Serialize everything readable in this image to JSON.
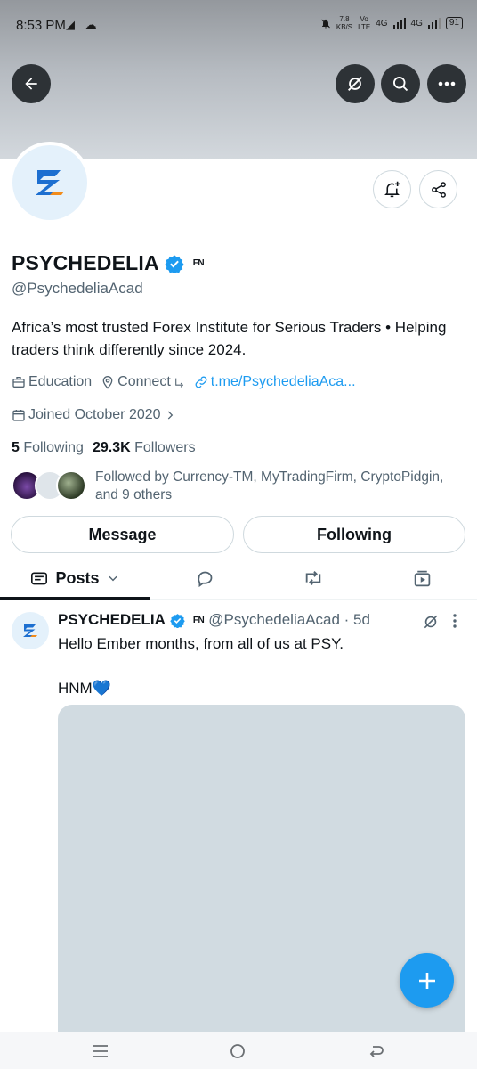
{
  "status_bar": {
    "time": "8:53 PM",
    "left_icons": "◢ ☁",
    "speed_top": "7.8",
    "speed_bottom": "KB/S",
    "volte_top": "Vo",
    "volte_bottom": "LTE",
    "net1": "4G",
    "net2": "4G",
    "battery": "91"
  },
  "header": {
    "back_icon": "arrow-left-icon",
    "grok_icon": "grok-icon",
    "search_icon": "search-icon",
    "more_icon": "more-icon"
  },
  "profile": {
    "display_name": "PSYCHEDELIA",
    "affiliate_badge": "FN",
    "handle": "@PsychedeliaAcad",
    "bio": "Africa’s most trusted Forex Institute for Serious Traders • Helping traders think differently since 2024.",
    "category": "Education",
    "connect_label": "Connect",
    "link": "t.me/PsychedeliaAca...",
    "joined": "Joined October 2020",
    "following_count": "5",
    "following_label": "Following",
    "followers_count": "29.3K",
    "followers_label": "Followers",
    "followed_by": "Followed by Currency-TM, MyTradingFirm, CryptoPidgin, and 9 others"
  },
  "actions": {
    "message_label": "Message",
    "following_label": "Following"
  },
  "tabs": {
    "posts_label": "Posts"
  },
  "post": {
    "name": "PSYCHEDELIA",
    "affiliate_badge": "FN",
    "handle_time": "@PsychedeliaAcad · 5d",
    "line1": "Hello Ember months, from all of us at PSY.",
    "line2": "HNM💙"
  },
  "colors": {
    "accent": "#1d9bf0",
    "verified": "#1d9bf0",
    "secondary_text": "#536471"
  }
}
